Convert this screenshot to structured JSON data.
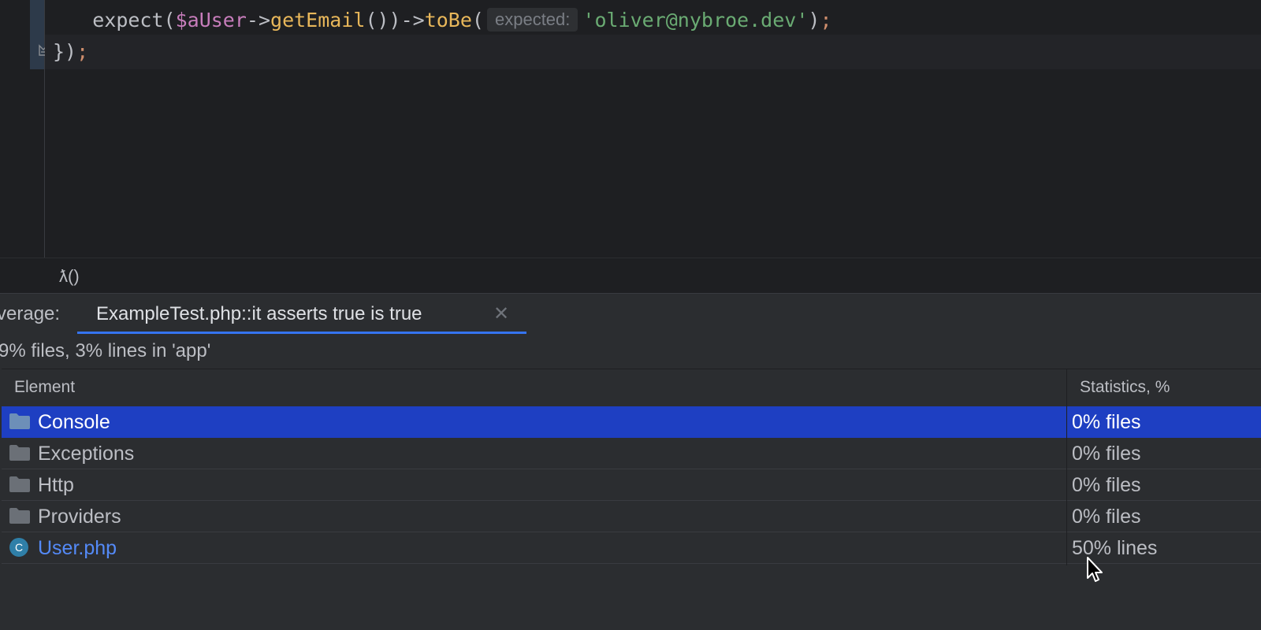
{
  "editor": {
    "lines": [
      {
        "indent": "    ",
        "fn": "expect",
        "open_paren": "(",
        "variable": "$aUser",
        "arrow1": "->",
        "method1": "getEmail",
        "call_parens": "())",
        "arrow2": "->",
        "method2": "toBe",
        "open_paren2": "(",
        "inlay_hint": "expected:",
        "string": "'oliver@nybroe.dev'",
        "close_paren": ")",
        "semicolon": ";"
      },
      {
        "brace": "})",
        "semicolon": ";"
      }
    ],
    "fold_icon": "fold-end-icon"
  },
  "breadcrumb": {
    "text": "ƛ()"
  },
  "coverage": {
    "title": "verage:",
    "tab": {
      "label": "ExampleTest.php::it asserts true is true",
      "close_glyph": "✕"
    },
    "summary": "9% files, 3% lines in 'app'",
    "columns": {
      "element": "Element",
      "statistics": "Statistics, %"
    },
    "rows": [
      {
        "name": "Console",
        "stat": "0% files",
        "icon": "folder-icon",
        "selected": true
      },
      {
        "name": "Exceptions",
        "stat": "0% files",
        "icon": "folder-icon",
        "selected": false
      },
      {
        "name": "Http",
        "stat": "0% files",
        "icon": "folder-icon",
        "selected": false
      },
      {
        "name": "Providers",
        "stat": "0% files",
        "icon": "folder-icon",
        "selected": false
      },
      {
        "name": "User.php",
        "stat": "50% lines",
        "icon": "php-class-icon",
        "selected": false
      }
    ]
  },
  "colors": {
    "accent": "#3574f0",
    "selection": "#1e3fc2",
    "editor_bg": "#1e1f22",
    "panel_bg": "#2b2d30"
  }
}
